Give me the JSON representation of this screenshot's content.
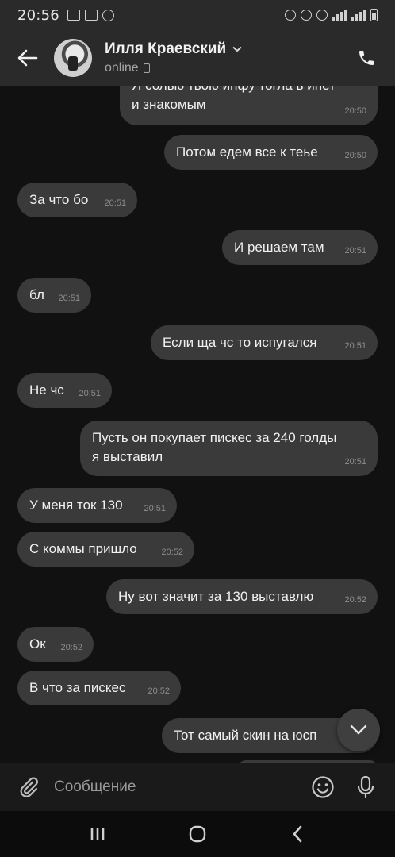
{
  "status_bar": {
    "time": "20:56"
  },
  "header": {
    "name": "Илля Краевский",
    "status": "online"
  },
  "messages": [
    {
      "side": "out",
      "text": "Я солью твою инфу тогла в инет и знакомым",
      "time": "20:50"
    },
    {
      "side": "out",
      "text": "Потом едем все к теье",
      "time": "20:50"
    },
    {
      "side": "in",
      "text": "За что бо",
      "time": "20:51"
    },
    {
      "side": "out",
      "text": "И решаем там",
      "time": "20:51"
    },
    {
      "side": "in",
      "text": "бл",
      "time": "20:51"
    },
    {
      "side": "out",
      "text": "Если ща чс то испугался",
      "time": "20:51"
    },
    {
      "side": "in",
      "text": "Не чс",
      "time": "20:51"
    },
    {
      "side": "out",
      "text": "Пусть он покупает пискес за 240 голды я выставил",
      "time": "20:51"
    },
    {
      "side": "in",
      "text": "У меня ток 130",
      "time": "20:51"
    },
    {
      "side": "in",
      "text": "С коммы пришло",
      "time": "20:52"
    },
    {
      "side": "out",
      "text": "Ну вот значит за 130 выставлю",
      "time": "20:52"
    },
    {
      "side": "in",
      "text": "Ок",
      "time": "20:52"
    },
    {
      "side": "in",
      "text": "В что за пискес",
      "time": "20:52"
    },
    {
      "side": "out",
      "text": "Тот самый скин на юсп",
      "time": ""
    }
  ],
  "input": {
    "placeholder": "Сообщение"
  },
  "colors": {
    "bubble": "#3a3a3a",
    "header": "#2a2a2a",
    "background": "#111111"
  }
}
